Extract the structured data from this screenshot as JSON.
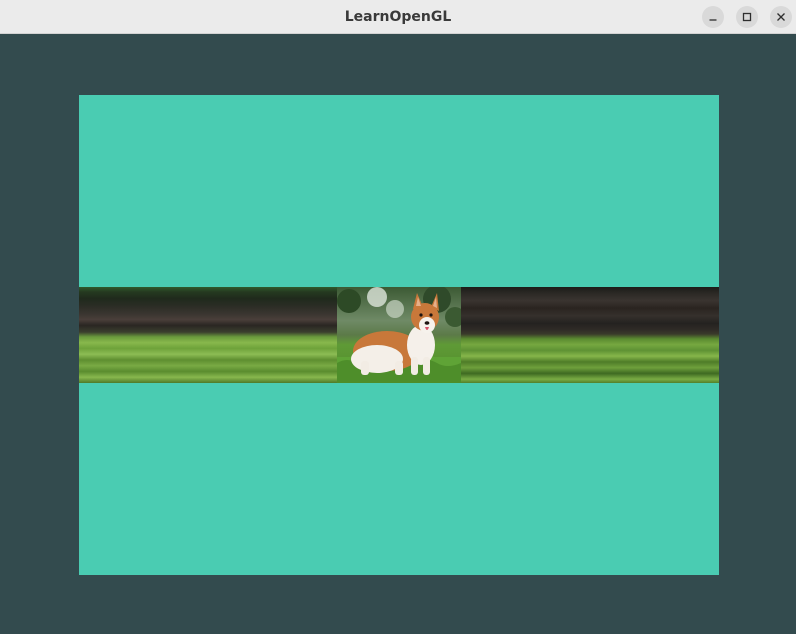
{
  "window": {
    "title": "LearnOpenGL",
    "controls": {
      "minimize": "minimize-icon",
      "maximize": "maximize-icon",
      "close": "close-icon"
    }
  },
  "viewport": {
    "clear_color": "#334b4e",
    "quad_color": "#4accb2",
    "texture": "corgi-dog-photo"
  }
}
